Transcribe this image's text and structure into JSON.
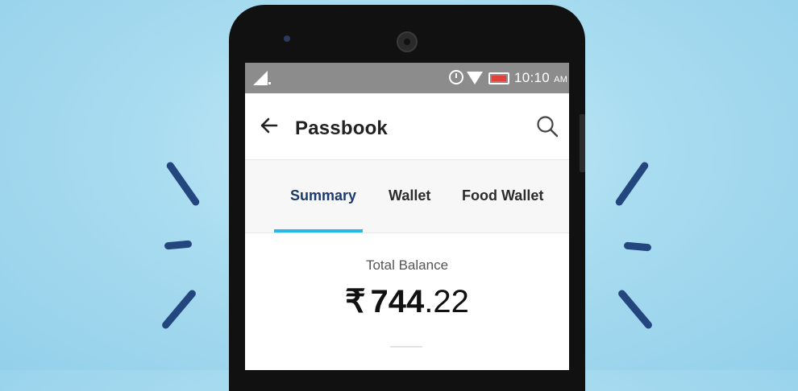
{
  "status_bar": {
    "time": "10:10",
    "am_pm": "AM",
    "icons": [
      "signal-icon",
      "alarm-icon",
      "wifi-icon",
      "battery-icon"
    ],
    "battery_color": "#e2403a"
  },
  "app_bar": {
    "title": "Passbook",
    "back_icon": "arrow-left-icon",
    "search_icon": "search-icon"
  },
  "tabs": [
    {
      "label": "Summary",
      "active": true
    },
    {
      "label": "Wallet",
      "active": false
    },
    {
      "label": "Food Wallet",
      "active": false
    }
  ],
  "balance": {
    "label": "Total Balance",
    "currency": "₹",
    "integer": "744",
    "decimal": ".22"
  },
  "colors": {
    "accent": "#29b6e8",
    "active_tab": "#1b3a6b",
    "background": "#a9dcf0",
    "strokes": "#23467f"
  }
}
